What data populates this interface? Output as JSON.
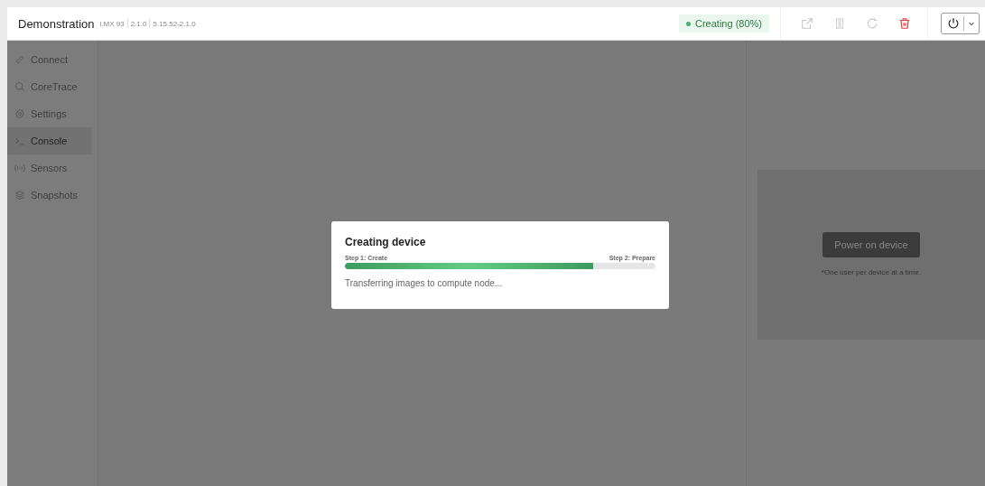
{
  "header": {
    "title": "Demonstration",
    "meta": [
      "i.MX 93",
      "2.1.0",
      "5.15.52-2.1.0"
    ],
    "status": {
      "label": "Creating (80%)",
      "color": "#4caf6e"
    }
  },
  "sidebar": {
    "items": [
      {
        "label": "Connect",
        "selected": false
      },
      {
        "label": "CoreTrace",
        "selected": false
      },
      {
        "label": "Settings",
        "selected": false
      },
      {
        "label": "Console",
        "selected": true
      },
      {
        "label": "Sensors",
        "selected": false
      },
      {
        "label": "Snapshots",
        "selected": false
      }
    ]
  },
  "dialog": {
    "title": "Creating device",
    "steps": [
      "Step 1: Create",
      "Step 2: Prepare"
    ],
    "level": 0.8,
    "message": "Transferring images to compute node..."
  },
  "power_panel": {
    "button": "Power on device",
    "note": "*One user per device at a time."
  }
}
